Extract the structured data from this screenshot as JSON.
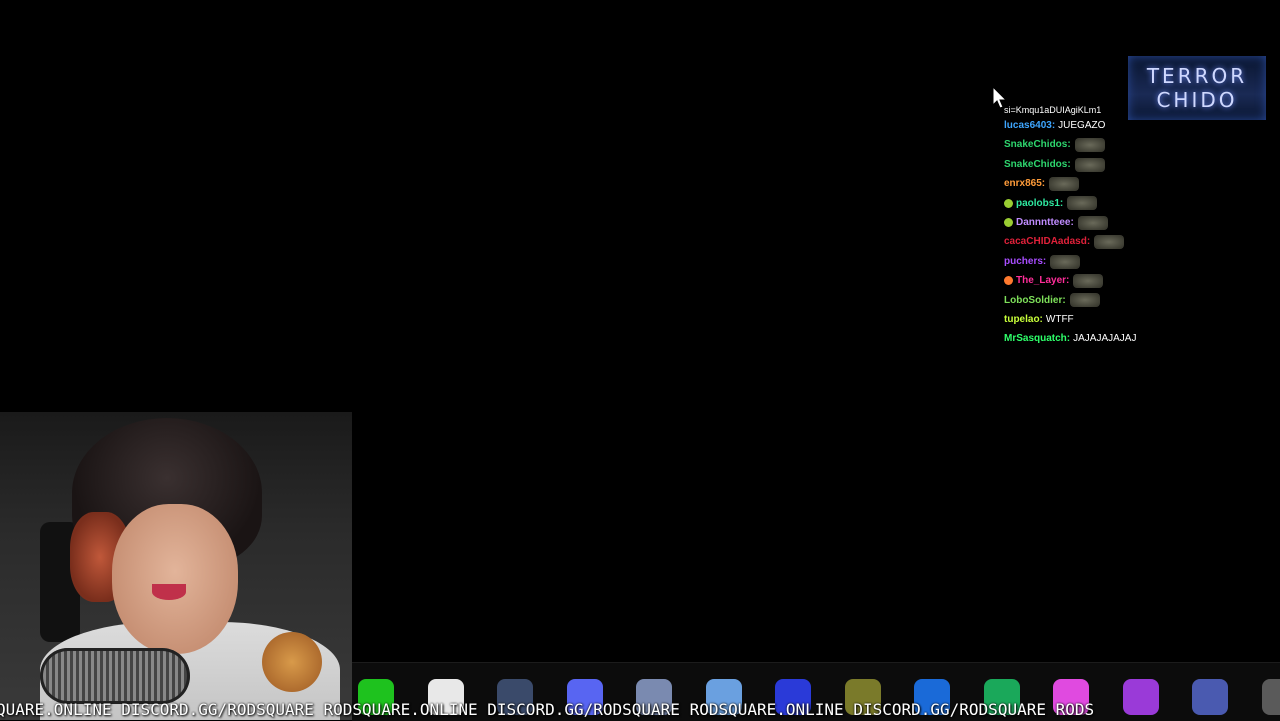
{
  "overlay": {
    "logo_line1": "TERROR",
    "logo_line2": "CHIDO",
    "ticker": "QUARE.ONLINE DISCORD.GG/RODSQUARE RODSQUARE.ONLINE DISCORD.GG/RODSQUARE RODSQUARE.ONLINE DISCORD.GG/RODSQUARE RODS"
  },
  "chat": {
    "cut_line": "si=Kmqu1aDUIAgiKLm1",
    "messages": [
      {
        "user": "lucas6403",
        "color": "#3ea6ff",
        "message": "JUEGAZO",
        "emote": false,
        "badge": ""
      },
      {
        "user": "SnakeChidos",
        "color": "#2ed66e",
        "message": "",
        "emote": true,
        "badge": ""
      },
      {
        "user": "SnakeChidos",
        "color": "#2ed66e",
        "message": "",
        "emote": true,
        "badge": ""
      },
      {
        "user": "enrx865",
        "color": "#ff9c3a",
        "message": "",
        "emote": true,
        "badge": ""
      },
      {
        "user": "paolobs1",
        "color": "#2ee8a0",
        "message": "",
        "emote": true,
        "badge": "#9acd32"
      },
      {
        "user": "Dannntteee",
        "color": "#c08cff",
        "message": "",
        "emote": true,
        "badge": "#9acd32"
      },
      {
        "user": "cacaCHIDAadasd",
        "color": "#e0213a",
        "message": "",
        "emote": true,
        "badge": ""
      },
      {
        "user": "puchers",
        "color": "#a84dff",
        "message": "",
        "emote": true,
        "badge": ""
      },
      {
        "user": "The_Layer",
        "color": "#ff2e9a",
        "message": "",
        "emote": true,
        "badge": "#ff7a2e"
      },
      {
        "user": "LoboSoldier",
        "color": "#7ee05a",
        "message": "",
        "emote": true,
        "badge": ""
      },
      {
        "user": "tupelao",
        "color": "#c8ff3a",
        "message": "WTFF",
        "emote": false,
        "badge": ""
      },
      {
        "user": "MrSasquatch",
        "color": "#2eff6a",
        "message": "JAJAJAJAJAJ",
        "emote": false,
        "badge": ""
      }
    ]
  },
  "taskbar": {
    "icons": [
      {
        "name": "green-app-icon",
        "color": "#1ec21e"
      },
      {
        "name": "white-app-icon",
        "color": "#e8e8e8"
      },
      {
        "name": "keyboard-app-icon",
        "color": "#3a4a6a"
      },
      {
        "name": "discord-icon",
        "color": "#5865f2"
      },
      {
        "name": "folder-icon",
        "color": "#7a8ab0"
      },
      {
        "name": "fingerprint-icon",
        "color": "#6aa0e0"
      },
      {
        "name": "v-app-icon",
        "color": "#2a3ad8"
      },
      {
        "name": "yellow-app-icon",
        "color": "#7a7a2a"
      },
      {
        "name": "blue-app-icon",
        "color": "#1a6ad8"
      },
      {
        "name": "home-app-icon",
        "color": "#1aa85a"
      },
      {
        "name": "color-wheel-icon",
        "color": "#e04ae0"
      },
      {
        "name": "purple-app-icon",
        "color": "#9a3ad8"
      },
      {
        "name": "obs-icon",
        "color": "#4a5ab0"
      },
      {
        "name": "grey-app-icon",
        "color": "#5a5a5a"
      }
    ]
  }
}
